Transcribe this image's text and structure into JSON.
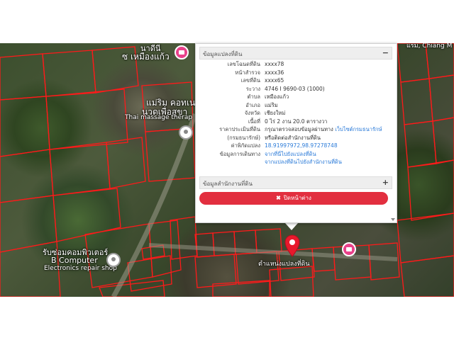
{
  "map": {
    "labels": [
      {
        "id": "temple",
        "text": "นาดีนี"
      },
      {
        "id": "district",
        "text": "ซ เหมืองแก้ว"
      },
      {
        "id": "massage_th",
        "text": "แม่ริม คอทเน"
      },
      {
        "id": "massage_th2",
        "text": "นวดเพื่อสุขา"
      },
      {
        "id": "massage_en",
        "text": "Thai massage therap"
      },
      {
        "id": "computer_th",
        "text": "รับซ่อมคอมพิวเตอร์"
      },
      {
        "id": "computer_en",
        "text": "B Computer"
      },
      {
        "id": "computer_desc",
        "text": "Electronics repair shop"
      },
      {
        "id": "location",
        "text": "ตำแหน่งแปลงที่ดิน"
      },
      {
        "id": "corner",
        "text": "แรม, Chiang M"
      }
    ],
    "colors": {
      "parcel_line": "#ff1a1a",
      "marker": "#e8192c",
      "poi_pink": "#e9418a"
    }
  },
  "popup": {
    "section1_title": "ข้อมูลแปลงที่ดิน",
    "section1_toggle": "−",
    "section2_title": "ข้อมูลสำนักงานที่ดิน",
    "section2_toggle": "+",
    "rows": [
      {
        "key": "เลขโฉนดที่ดิน",
        "value": "xxxx78"
      },
      {
        "key": "หน้าสำรวจ",
        "value": "xxxx36"
      },
      {
        "key": "เลขที่ดิน",
        "value": "xxxx65"
      },
      {
        "key": "ระวาง",
        "value": "4746 I 9690-03 (1000)"
      },
      {
        "key": "ตำบล",
        "value": "เหมืองแก้ว"
      },
      {
        "key": "อำเภอ",
        "value": "แม่ริม"
      },
      {
        "key": "จังหวัด",
        "value": "เชียงใหม่"
      },
      {
        "key": "เนื้อที่",
        "value": "0 ไร่ 2 งาน 20.0 ตารางวา"
      },
      {
        "key": "ราคาประเมินที่ดิน",
        "value": "กรุณาตรวจสอบข้อมูลผ่านทาง",
        "link": "เว็บไซต์กรมธนารักษ์"
      },
      {
        "key": "(กรมธนารักษ์)",
        "value": "หรือติดต่อสำนักงานที่ดิน"
      },
      {
        "key": "ค่าพิกัดแปลง",
        "value": "",
        "link": "18.91997972,98.97278748"
      },
      {
        "key": "ข้อมูลการเดินทาง",
        "value": "",
        "link": "จากที่นี่ไปยังแปลงที่ดิน"
      },
      {
        "key": "",
        "value": "",
        "link": "จากแปลงที่ดินไปยังสำนักงานที่ดิน"
      }
    ],
    "close_label": "ปิดหน้าต่าง",
    "close_icon": "close-icon"
  }
}
